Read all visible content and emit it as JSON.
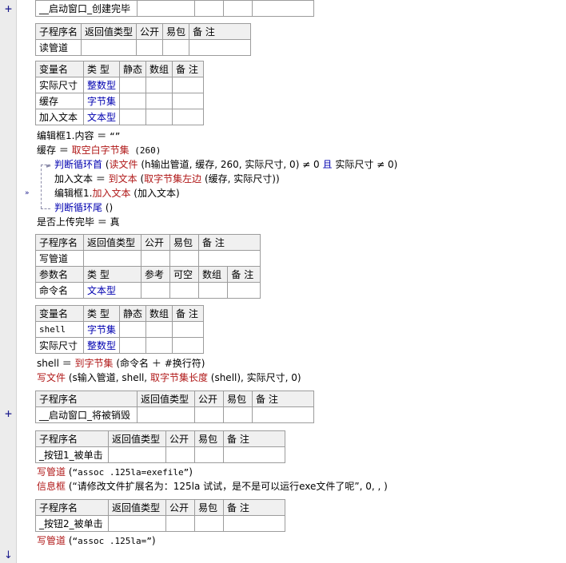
{
  "sub1": {
    "name": "__启动窗口_创建完毕"
  },
  "sub2": {
    "headers": [
      "子程序名",
      "返回值类型",
      "公开",
      "易包",
      "备 注"
    ],
    "name": "读管道"
  },
  "vars2": {
    "headers": [
      "变量名",
      "类 型",
      "静态",
      "数组",
      "备 注"
    ],
    "rows": [
      {
        "name": "实际尺寸",
        "type": "整数型"
      },
      {
        "name": "缓存",
        "type": "字节集"
      },
      {
        "name": "加入文本",
        "type": "文本型"
      }
    ]
  },
  "code2": {
    "l1": {
      "a": "编辑框1.内容 ＝ ",
      "b": "“”"
    },
    "l2": {
      "a": "缓存 ＝ ",
      "b": "取空白字节集",
      "c": " (260)"
    },
    "l3": {
      "a": "判断循环首",
      "b": " (",
      "c": "读文件",
      "d": " (h输出管道, 缓存, 260, 实际尺寸, 0) ≠ 0 ",
      "e": "且",
      "f": " 实际尺寸 ≠ 0)"
    },
    "l4": {
      "a": "加入文本 ＝ ",
      "b": "到文本",
      "c": " (",
      "d": "取字节集左边",
      "e": " (缓存, 实际尺寸))"
    },
    "l5": {
      "a": "编辑框1.",
      "b": "加入文本",
      "c": " (加入文本)"
    },
    "l6": {
      "a": "判断循环尾",
      "b": " ()"
    },
    "l7": {
      "a": "是否上传完毕 ＝ 真"
    }
  },
  "sub3": {
    "headers": [
      "子程序名",
      "返回值类型",
      "公开",
      "易包",
      "备 注"
    ],
    "name": "写管道",
    "param_headers": [
      "参数名",
      "类 型",
      "参考",
      "可空",
      "数组",
      "备 注"
    ],
    "param": {
      "name": "命令名",
      "type": "文本型"
    }
  },
  "vars3": {
    "headers": [
      "变量名",
      "类 型",
      "静态",
      "数组",
      "备 注"
    ],
    "rows": [
      {
        "name": "shell",
        "type": "字节集"
      },
      {
        "name": "实际尺寸",
        "type": "整数型"
      }
    ]
  },
  "code3": {
    "l1": {
      "a": "shell ＝ ",
      "b": "到字节集",
      "c": " (命令名 ＋ #换行符)"
    },
    "l2": {
      "a": "写文件",
      "b": " (s输入管道, shell, ",
      "c": "取字节集长度",
      "d": " (shell), 实际尺寸, 0)"
    }
  },
  "sub4": {
    "headers": [
      "子程序名",
      "返回值类型",
      "公开",
      "易包",
      "备 注"
    ],
    "name": "__启动窗口_将被销毁"
  },
  "sub5": {
    "headers": [
      "子程序名",
      "返回值类型",
      "公开",
      "易包",
      "备 注"
    ],
    "name": "_按钮1_被单击"
  },
  "code5": {
    "l1": {
      "a": "写管道",
      "b": " (",
      "c": "“assoc .125la=exefile”",
      "d": ")"
    },
    "l2": {
      "a": "信息框",
      "b": " (",
      "c": "“请修改文件扩展名为：125la 试试，是不是可以运行exe文件了呢”",
      "d": ", 0, , )"
    }
  },
  "sub6": {
    "headers": [
      "子程序名",
      "返回值类型",
      "公开",
      "易包",
      "备 注"
    ],
    "name": "_按钮2_被单击"
  },
  "code6": {
    "l1": {
      "a": "写管道",
      "b": " (",
      "c": "“assoc .125la=”",
      "d": ")"
    }
  },
  "gutter": {
    "plus": "+",
    "arrow": "↓",
    "fold": "»"
  },
  "colors": {
    "keyword": "#0000b0",
    "func": "#b01818",
    "header_bg": "#f0f0f0",
    "border": "#9c9c9c"
  }
}
